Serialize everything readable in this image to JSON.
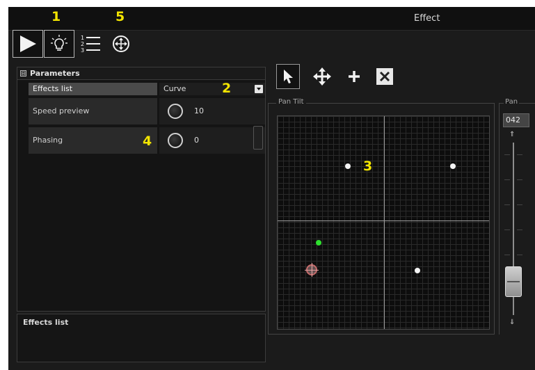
{
  "window": {
    "title": "Effect"
  },
  "callouts": {
    "c1": "1",
    "c2": "2",
    "c3": "3",
    "c4": "4",
    "c5": "5"
  },
  "toolbar": {
    "items": [
      {
        "icon": "play-icon",
        "active": true
      },
      {
        "icon": "lightbulb-icon",
        "active": true
      },
      {
        "icon": "numbered-list-icon",
        "active": false
      },
      {
        "icon": "crosshair-move-icon",
        "active": false
      }
    ]
  },
  "parameters": {
    "title": "Parameters",
    "collapse_symbol": "⊟",
    "rows": [
      {
        "label": "Effects list",
        "value": "Curve",
        "control": "dropdown"
      },
      {
        "label": "Speed preview",
        "value": "10",
        "control": "knob"
      },
      {
        "label": "Phasing",
        "value": "0",
        "control": "knob"
      }
    ]
  },
  "description": {
    "title": "Effects list"
  },
  "pan_tilt": {
    "label": "Pan Tilt",
    "tools": [
      {
        "icon": "pointer-arrow-icon",
        "active": true
      },
      {
        "icon": "move-arrows-icon",
        "active": false
      },
      {
        "icon": "plus-icon",
        "active": false
      },
      {
        "icon": "delete-x-icon",
        "active": false
      }
    ]
  },
  "pan_fader": {
    "label": "Pan",
    "value": "042",
    "up_symbol": "⇑",
    "down_symbol": "⇓"
  },
  "colors": {
    "callout": "#f2e400",
    "green_point": "#2ee02e",
    "cursor": "#c56b6b"
  }
}
